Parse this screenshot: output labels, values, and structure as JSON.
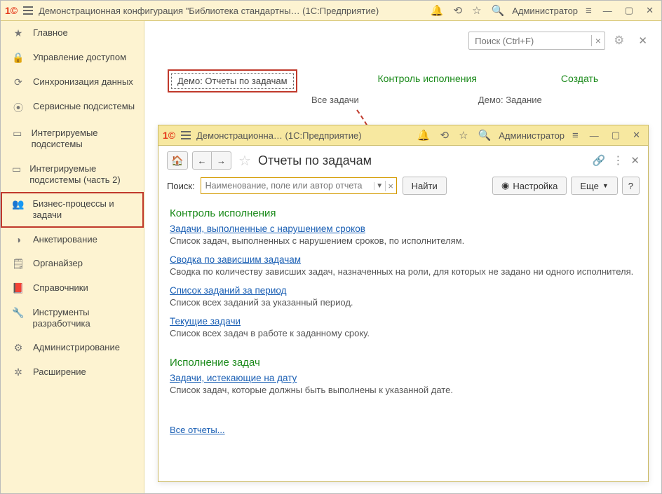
{
  "outer": {
    "title": "Демонстрационная конфигурация \"Библиотека стандартны…  (1С:Предприятие)",
    "user": "Администратор"
  },
  "sidebar": {
    "items": [
      {
        "icon": "★",
        "label": "Главное"
      },
      {
        "icon": "🔒",
        "label": "Управление доступом"
      },
      {
        "icon": "⟳",
        "label": "Синхронизация данных"
      },
      {
        "icon": "⦿",
        "label": "Сервисные подсистемы"
      },
      {
        "icon": "▭",
        "label": "Интегрируемые подсистемы"
      },
      {
        "icon": "▭",
        "label": "Интегрируемые подсистемы (часть 2)"
      },
      {
        "icon": "👥",
        "label": "Бизнес-процессы и задачи"
      },
      {
        "icon": "◑",
        "label": "Анкетирование"
      },
      {
        "icon": "🗒",
        "label": "Органайзер"
      },
      {
        "icon": "📕",
        "label": "Справочники"
      },
      {
        "icon": "🔧",
        "label": "Инструменты разработчика"
      },
      {
        "icon": "⚙",
        "label": "Администрирование"
      },
      {
        "icon": "✲",
        "label": "Расширение"
      }
    ]
  },
  "main": {
    "search_placeholder": "Поиск (Ctrl+F)",
    "demo_link": "Демо: Отчеты по задачам",
    "link_control": "Контроль исполнения",
    "link_create": "Создать",
    "sub_all_tasks": "Все задачи",
    "sub_demo_task": "Демо: Задание"
  },
  "nested": {
    "title": "Демонстрационна…  (1С:Предприятие)",
    "user": "Администратор",
    "page_title": "Отчеты по задачам",
    "search_label": "Поиск:",
    "search_placeholder": "Наименование, поле или автор отчета",
    "find_btn": "Найти",
    "settings_btn": "Настройка",
    "more_btn": "Еще",
    "help_btn": "?",
    "sections": [
      {
        "title": "Контроль исполнения",
        "reports": [
          {
            "name": "Задачи, выполненные с нарушением сроков",
            "desc": "Список задач, выполненных с нарушением сроков, по исполнителям."
          },
          {
            "name": "Сводка по зависшим задачам",
            "desc": "Сводка по количеству зависших задач, назначенных на роли, для которых не задано ни одного исполнителя."
          },
          {
            "name": "Список заданий за период",
            "desc": "Список всех заданий за указанный период."
          },
          {
            "name": "Текущие задачи",
            "desc": "Список всех задач в работе к заданному сроку."
          }
        ]
      },
      {
        "title": "Исполнение задач",
        "reports": [
          {
            "name": "Задачи, истекающие на дату",
            "desc": "Список задач, которые должны быть выполнены к указанной дате."
          }
        ]
      }
    ],
    "all_reports": "Все отчеты..."
  }
}
